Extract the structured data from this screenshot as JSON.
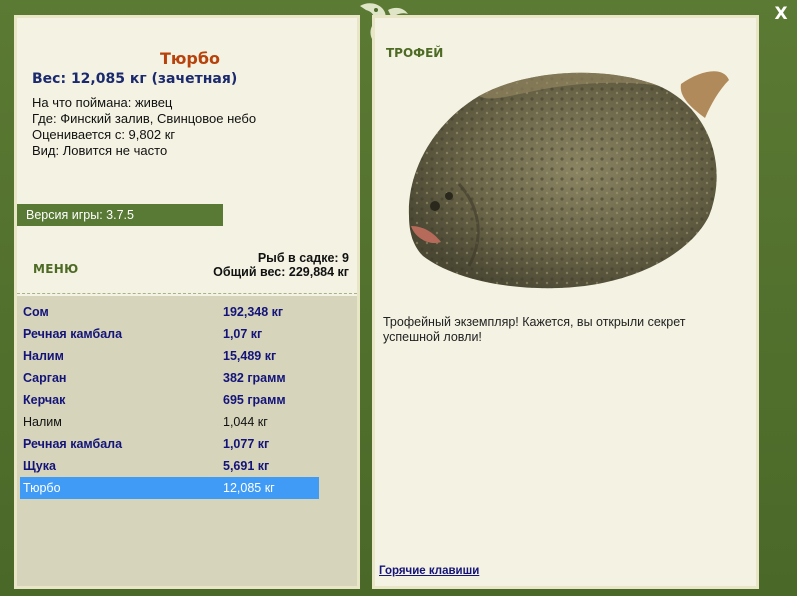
{
  "fish": {
    "title": "Тюрбо",
    "weight_line": "Вес: 12,085 кг (зачетная)",
    "info": [
      "На что поймана: живец",
      "Где: Финский залив, Свинцовое небо",
      "Оценивается с: 9,802 кг",
      "Вид: Ловится не часто"
    ]
  },
  "version": "Версия игры: 3.7.5",
  "menu_label": "МЕНЮ",
  "stats": {
    "count": "Рыб в садке: 9",
    "total": "Общий вес: 229,884 кг"
  },
  "catch_list": [
    {
      "name": "Сом",
      "weight": "192,348 кг"
    },
    {
      "name": "Речная камбала",
      "weight": "1,07 кг"
    },
    {
      "name": "Налим",
      "weight": "15,489 кг"
    },
    {
      "name": "Сарган",
      "weight": "382 грамм"
    },
    {
      "name": "Керчак",
      "weight": "695 грамм"
    },
    {
      "name": "Налим",
      "weight": "1,044 кг"
    },
    {
      "name": "Речная камбала",
      "weight": "1,077 кг"
    },
    {
      "name": "Щука",
      "weight": "5,691 кг"
    },
    {
      "name": "Тюрбо",
      "weight": "12,085 кг"
    }
  ],
  "right_panel": {
    "trophy_label": "ТРОФЕЙ",
    "description": "Трофейный экземпляр! Кажется, вы открыли секрет успешной ловли!",
    "hotkeys_link": "Горячие клавиши"
  },
  "close_label": "X",
  "colors": {
    "frame": "#4f6d2c",
    "panel": "#f4f2e2",
    "selected_row": "#3f9bf6",
    "title": "#b8420c",
    "link": "#13137a"
  }
}
